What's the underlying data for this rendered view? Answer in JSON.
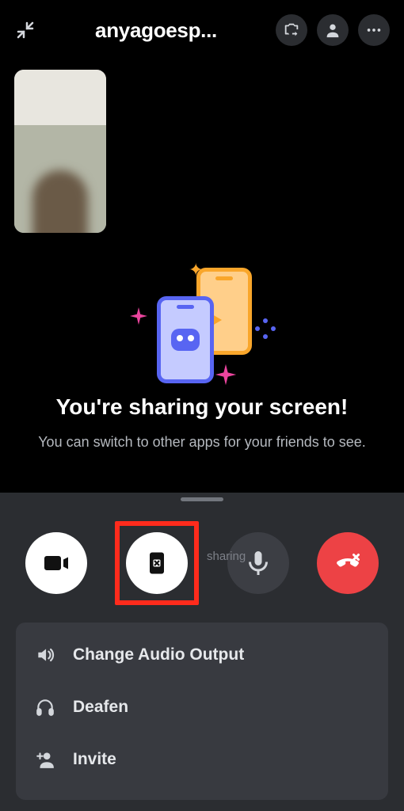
{
  "header": {
    "title": "anyagoesp...",
    "collapse_icon": "collapse-icon",
    "swap_camera_icon": "swap-camera-icon",
    "add_person_icon": "person-icon",
    "more_icon": "more-icon"
  },
  "screen_share": {
    "title": "You're sharing your screen!",
    "subtitle": "You can switch to other apps for your friends to see."
  },
  "controls": {
    "video_icon": "video-icon",
    "stop_share_icon": "stop-screen-share-icon",
    "stop_share_hint": "sharing",
    "mic_icon": "microphone-icon",
    "hangup_icon": "hangup-icon"
  },
  "menu": {
    "items": [
      {
        "icon": "speaker-icon",
        "label": "Change Audio Output"
      },
      {
        "icon": "headphones-icon",
        "label": "Deafen"
      },
      {
        "icon": "invite-icon",
        "label": "Invite"
      }
    ]
  },
  "colors": {
    "accent_red": "#ed4245",
    "highlight": "#ff2b1c",
    "blurple": "#5865f2",
    "orange": "#f9a62b",
    "pink": "#eb459e"
  }
}
